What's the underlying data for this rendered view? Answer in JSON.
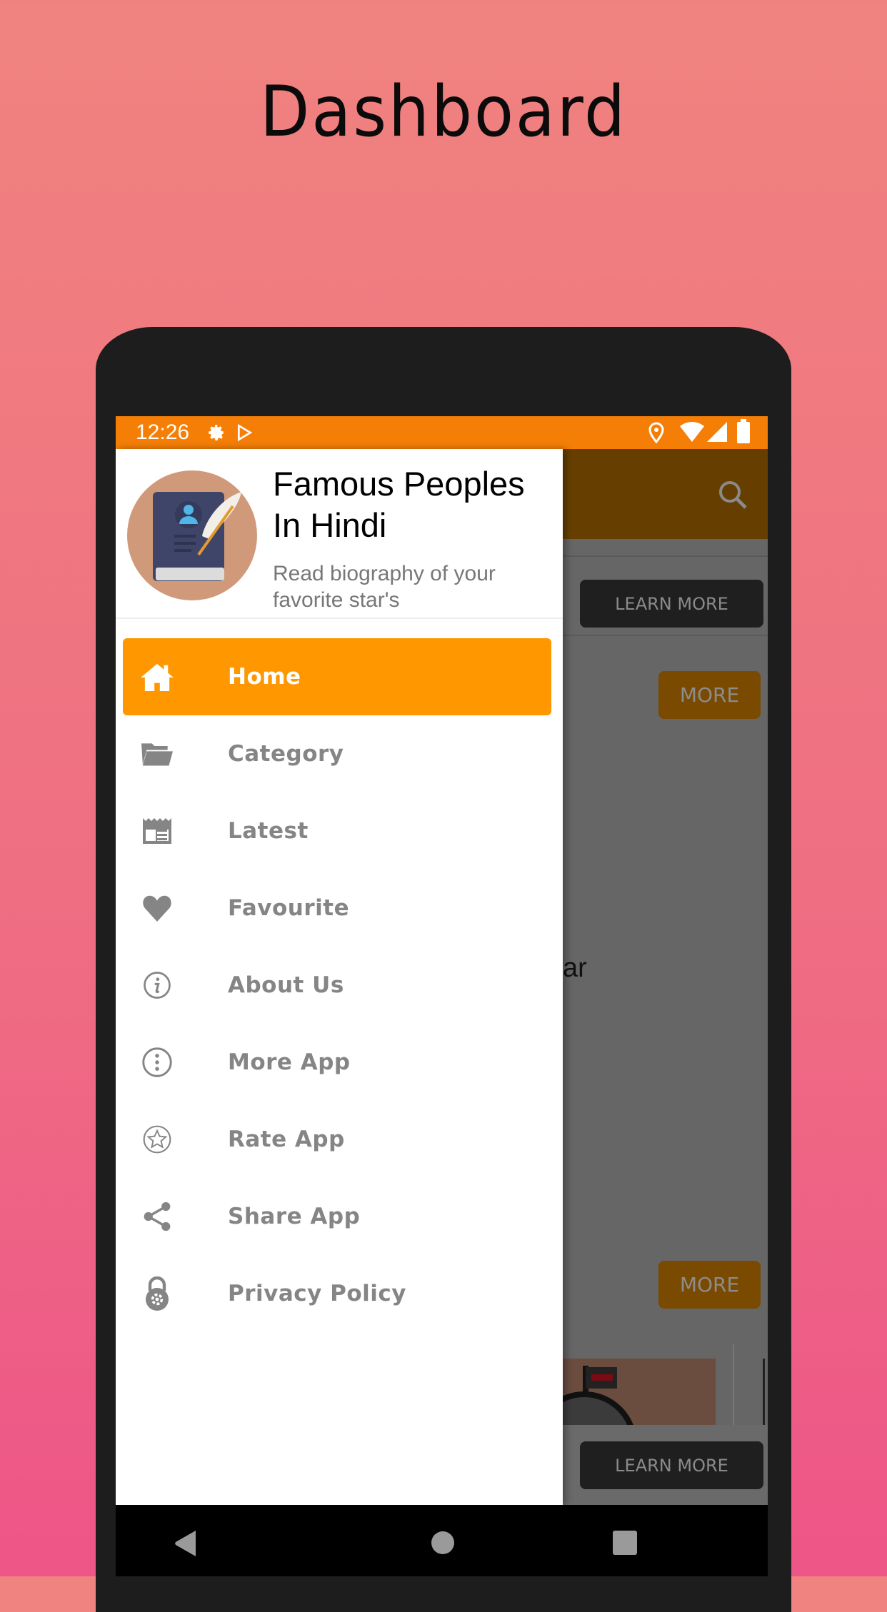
{
  "page_title": "Dashboard",
  "status_bar": {
    "time": "12:26",
    "left_icons": [
      "gear-icon",
      "play-store-icon"
    ],
    "right_icons": [
      "location-icon",
      "wifi-icon",
      "signal-icon",
      "battery-icon"
    ]
  },
  "drawer": {
    "app_title_line1": "Famous Peoples",
    "app_title_line2": "In Hindi",
    "app_subtitle": "Read biography of your favorite star's",
    "items": [
      {
        "label": "Home",
        "icon": "home-icon",
        "active": true
      },
      {
        "label": "Category",
        "icon": "folder-icon",
        "active": false
      },
      {
        "label": "Latest",
        "icon": "newspaper-icon",
        "active": false
      },
      {
        "label": "Favourite",
        "icon": "heart-icon",
        "active": false
      },
      {
        "label": "About Us",
        "icon": "info-icon",
        "active": false
      },
      {
        "label": "More App",
        "icon": "more-vertical-icon",
        "active": false
      },
      {
        "label": "Rate App",
        "icon": "star-icon",
        "active": false
      },
      {
        "label": "Share App",
        "icon": "share-icon",
        "active": false
      },
      {
        "label": "Privacy Policy",
        "icon": "privacy-lock-icon",
        "active": false
      }
    ]
  },
  "background_screen": {
    "learn_more_1": "LEARN MORE",
    "more_1": "MORE",
    "partial_text": "ar",
    "more_2": "MORE",
    "learn_more_2": "LEARN MORE"
  },
  "colors": {
    "accent": "#FF9700",
    "status_bar": "#F57F06",
    "menu_text": "#858585"
  }
}
